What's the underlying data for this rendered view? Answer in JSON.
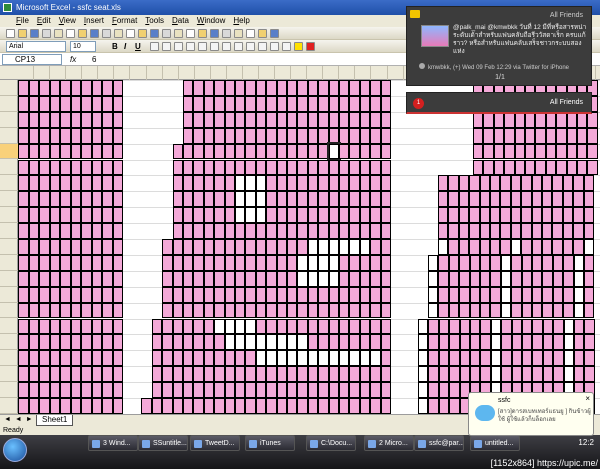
{
  "window": {
    "title": "Microsoft Excel - ssfc seat.xls"
  },
  "menu": [
    "File",
    "Edit",
    "View",
    "Insert",
    "Format",
    "Tools",
    "Data",
    "Window",
    "Help"
  ],
  "toolbar": {
    "font": "Arial",
    "size": "10",
    "bold": "B",
    "italic": "I",
    "underline": "U"
  },
  "formula": {
    "cell": "CP13",
    "fx": "fx",
    "value": "6"
  },
  "columns": [
    "BM",
    "BN",
    "BO",
    "BP",
    "BQ",
    "BR",
    "BS",
    "BT",
    "BU",
    "BV",
    "BW",
    "BX",
    "BY",
    "BZ",
    "CA",
    "CB",
    "CC",
    "CD",
    "CE",
    "CF",
    "CG",
    "CH",
    "CI",
    "CJ",
    "CK",
    "CL",
    "CM",
    "CN",
    "CO",
    "CP",
    "CQ",
    "CR",
    "CS",
    "CT",
    "CU",
    "CV"
  ],
  "selected_column": "CP",
  "rows": [
    9,
    10,
    11,
    12,
    13,
    14,
    15,
    16,
    17,
    18,
    19,
    20,
    21,
    22,
    23,
    24,
    25,
    26,
    27,
    28,
    29
  ],
  "selected_row": 13,
  "pink": "#f4a9d8",
  "grid_rows": [
    {
      "left": [
        "10",
        "9",
        "8",
        "7",
        "6",
        "5",
        "4",
        "3",
        "2",
        "1"
      ],
      "right": [
        "20",
        "19",
        "18",
        "17",
        "16",
        "15",
        "14",
        "13",
        "12",
        "11",
        "10",
        "9",
        "8",
        "7",
        "6",
        "5",
        "4",
        "3",
        "2",
        "1"
      ],
      "white": []
    },
    {
      "left": [
        "10",
        "9",
        "8",
        "7",
        "6",
        "5",
        "4",
        "3",
        "2",
        "1"
      ],
      "right": [
        "20",
        "19",
        "18",
        "17",
        "16",
        "15",
        "14",
        "13",
        "12",
        "11",
        "10",
        "9",
        "8",
        "7",
        "6",
        "5",
        "4",
        "3",
        "2",
        "1"
      ],
      "white": []
    },
    {
      "left": [
        "10",
        "9",
        "8",
        "7",
        "6",
        "5",
        "4",
        "3",
        "2",
        "1"
      ],
      "right": [
        "20",
        "19",
        "18",
        "17",
        "16",
        "15",
        "14",
        "13",
        "12",
        "11",
        "10",
        "9",
        "8",
        "7",
        "6",
        "5",
        "4",
        "3",
        "2",
        "1"
      ],
      "white": []
    },
    {
      "left": [
        "10",
        "9",
        "8",
        "7",
        "6",
        "5",
        "4",
        "3",
        "2",
        "1"
      ],
      "right": [
        "20",
        "19",
        "18",
        "17",
        "16",
        "15",
        "14",
        "13",
        "12",
        "11",
        "10",
        "9",
        "8",
        "7",
        "6",
        "5",
        "4",
        "3",
        "2",
        "1"
      ],
      "white": []
    },
    {
      "left": [
        "10",
        "9",
        "8",
        "7",
        "6",
        "5",
        "4",
        "3",
        "2",
        "1"
      ],
      "right": [
        "21",
        "20",
        "19",
        "18",
        "17",
        "16",
        "15",
        "14",
        "13",
        "12",
        "11",
        "10",
        "9",
        "8",
        "7",
        "6",
        "5",
        "4",
        "3",
        "2",
        "1"
      ],
      "white": [
        15
      ]
    },
    {
      "left": [
        "10",
        "9",
        "8",
        "7",
        "6",
        "5",
        "4",
        "3",
        "2",
        "1"
      ],
      "right": [
        "21",
        "20",
        "19",
        "18",
        "17",
        "16",
        "15",
        "14",
        "13",
        "12",
        "11",
        "10",
        "9",
        "8",
        "7",
        "6",
        "5",
        "4",
        "3",
        "2",
        "1"
      ],
      "white": []
    },
    {
      "left": [
        "10",
        "9",
        "8",
        "7",
        "6",
        "5",
        "4",
        "3",
        "2",
        "1"
      ],
      "right": [
        "21",
        "20",
        "19",
        "18",
        "17",
        "16",
        "15",
        "14",
        "13",
        "12",
        "11",
        "10",
        "9",
        "8",
        "7",
        "6",
        "5",
        "4",
        "3",
        "2",
        "1"
      ],
      "white": [
        6,
        7,
        8
      ]
    },
    {
      "left": [
        "10",
        "9",
        "8",
        "7",
        "6",
        "5",
        "4",
        "3",
        "2",
        "1"
      ],
      "right": [
        "21",
        "20",
        "19",
        "18",
        "17",
        "16",
        "15",
        "14",
        "13",
        "12",
        "11",
        "10",
        "9",
        "8",
        "7",
        "6",
        "5",
        "4",
        "3",
        "2",
        "1"
      ],
      "white": [
        6,
        7,
        8
      ]
    },
    {
      "left": [
        "10",
        "9",
        "8",
        "7",
        "6",
        "5",
        "4",
        "3",
        "2",
        "1"
      ],
      "right": [
        "21",
        "20",
        "19",
        "18",
        "17",
        "16",
        "15",
        "14",
        "13",
        "12",
        "11",
        "10",
        "9",
        "8",
        "7",
        "6",
        "5",
        "4",
        "3",
        "2",
        "1"
      ],
      "white": [
        6,
        7,
        8
      ]
    },
    {
      "left": [
        "10",
        "9",
        "8",
        "7",
        "6",
        "5",
        "4",
        "3",
        "2",
        "1"
      ],
      "right": [
        "21",
        "20",
        "19",
        "18",
        "17",
        "16",
        "15",
        "14",
        "13",
        "12",
        "11",
        "10",
        "9",
        "8",
        "7",
        "6",
        "5",
        "4",
        "3",
        "2",
        "1"
      ],
      "white": []
    },
    {
      "left": [
        "10",
        "9",
        "8",
        "7",
        "6",
        "5",
        "4",
        "3",
        "2",
        "1"
      ],
      "right": [
        "22",
        "21",
        "20",
        "19",
        "18",
        "17",
        "16",
        "15",
        "14",
        "13",
        "12",
        "11",
        "10",
        "9",
        "8",
        "7",
        "6",
        "5",
        "4",
        "3",
        "2",
        "1"
      ],
      "white": [
        14,
        15,
        16,
        17,
        18,
        19
      ]
    },
    {
      "left": [
        "10",
        "9",
        "8",
        "7",
        "6",
        "5",
        "4",
        "3",
        "2",
        "1"
      ],
      "right": [
        "22",
        "21",
        "20",
        "19",
        "18",
        "17",
        "16",
        "15",
        "14",
        "13",
        "12",
        "11",
        "10",
        "9",
        "8",
        "7",
        "6",
        "5",
        "4",
        "3",
        "2",
        "1"
      ],
      "white": [
        13,
        14,
        15,
        16
      ]
    },
    {
      "left": [
        "10",
        "9",
        "8",
        "7",
        "6",
        "5",
        "4",
        "3",
        "2",
        "1"
      ],
      "right": [
        "22",
        "21",
        "20",
        "19",
        "18",
        "17",
        "16",
        "15",
        "14",
        "13",
        "12",
        "11",
        "10",
        "9",
        "8",
        "7",
        "6",
        "5",
        "4",
        "3",
        "2",
        "1"
      ],
      "white": [
        13,
        14,
        15,
        16
      ]
    },
    {
      "left": [
        "10",
        "9",
        "8",
        "7",
        "6",
        "5",
        "4",
        "3",
        "2",
        "1"
      ],
      "right": [
        "22",
        "21",
        "20",
        "19",
        "18",
        "17",
        "16",
        "15",
        "14",
        "13",
        "12",
        "11",
        "10",
        "9",
        "8",
        "7",
        "6",
        "5",
        "4",
        "3",
        "2",
        "1"
      ],
      "white": []
    },
    {
      "left": [
        "10",
        "9",
        "8",
        "7",
        "6",
        "5",
        "4",
        "3",
        "2",
        "1"
      ],
      "right": [
        "22",
        "21",
        "20",
        "19",
        "18",
        "17",
        "16",
        "15",
        "14",
        "13",
        "12",
        "11",
        "10",
        "9",
        "8",
        "7",
        "6",
        "5",
        "4",
        "3",
        "2",
        "1"
      ],
      "white": []
    },
    {
      "left": [
        "10",
        "9",
        "8",
        "7",
        "6",
        "5",
        "4",
        "3",
        "2",
        "1"
      ],
      "right": [
        "23",
        "22",
        "21",
        "20",
        "19",
        "18",
        "17",
        "16",
        "15",
        "14",
        "13",
        "12",
        "11",
        "10",
        "9",
        "8",
        "7",
        "6",
        "5",
        "4",
        "3",
        "2",
        "1"
      ],
      "white": [
        6,
        7,
        8,
        9
      ]
    },
    {
      "left": [
        "10",
        "9",
        "8",
        "7",
        "6",
        "5",
        "4",
        "3",
        "2",
        "1"
      ],
      "right": [
        "23",
        "22",
        "21",
        "20",
        "19",
        "18",
        "17",
        "16",
        "15",
        "14",
        "13",
        "12",
        "11",
        "10",
        "9",
        "8",
        "7",
        "6",
        "5",
        "4",
        "3",
        "2",
        "1"
      ],
      "white": [
        7,
        8,
        9,
        10,
        11,
        12,
        13,
        14
      ]
    },
    {
      "left": [
        "10",
        "9",
        "8",
        "7",
        "6",
        "5",
        "4",
        "3",
        "2",
        "1"
      ],
      "right": [
        "23",
        "22",
        "21",
        "20",
        "19",
        "18",
        "17",
        "16",
        "15",
        "14",
        "13",
        "12",
        "11",
        "10",
        "9",
        "8",
        "7",
        "6",
        "5",
        "4",
        "3",
        "2",
        "1"
      ],
      "white": [
        10,
        11,
        12,
        13,
        14,
        15,
        16,
        17,
        18,
        19,
        20,
        21
      ]
    },
    {
      "left": [
        "10",
        "9",
        "8",
        "7",
        "6",
        "5",
        "4",
        "3",
        "2",
        "1"
      ],
      "right": [
        "23",
        "22",
        "21",
        "20",
        "19",
        "18",
        "17",
        "16",
        "15",
        "14",
        "13",
        "12",
        "11",
        "10",
        "9",
        "8",
        "7",
        "6",
        "5",
        "4",
        "3",
        "2",
        "1"
      ],
      "white": []
    },
    {
      "left": [
        "10",
        "9",
        "8",
        "7",
        "6",
        "5",
        "4",
        "3",
        "2",
        "1"
      ],
      "right": [
        "23",
        "22",
        "21",
        "20",
        "19",
        "18",
        "17",
        "16",
        "15",
        "14",
        "13",
        "12",
        "11",
        "10",
        "9",
        "8",
        "7",
        "6",
        "5",
        "4",
        "3",
        "2",
        "1"
      ],
      "white": []
    },
    {
      "left": [
        "10",
        "9",
        "8",
        "7",
        "6",
        "5",
        "4",
        "3",
        "2",
        "1"
      ],
      "right": [
        "24",
        "23",
        "22",
        "21",
        "20",
        "19",
        "18",
        "17",
        "16",
        "15",
        "14",
        "13",
        "12",
        "11",
        "10",
        "9",
        "8",
        "7",
        "6",
        "5",
        "4",
        "3",
        "2",
        "1"
      ],
      "white": []
    }
  ],
  "sheets": {
    "nav": "◄ ◄ ► ►",
    "active": "Sheet1"
  },
  "status": {
    "text": "Ready"
  },
  "taskbar": {
    "buttons": [
      "3 Wind...",
      "SSuntitle...",
      "TweetD...",
      "iTunes",
      "C:\\Docu...",
      "2 Micro...",
      "ssfc@par...",
      "untitled..."
    ],
    "clock": "12:2"
  },
  "tweet": {
    "header": "All Friends",
    "text": "@palk_mai @kmwbkk วันที่ 12 มีที่หรือสารหน่า ระดับเด้าสำหรับแฟนคลับถือรีววัสดาเร็ก ครบแก้ ราว? หรือสำหรับแฟนคลับเสร็จชาวกระบบสองแห่ง",
    "meta": "kmwbkk, (+) Wed 09 Feb 12:29 via Twitter for iPhone",
    "page": "1/1"
  },
  "friends": {
    "count": "1",
    "label": "All Friends"
  },
  "notification": {
    "title": "ssfc",
    "body": "[สาว]ดารสเบทเทอร์แธนยู ] กินข้าวผู้ใช้ ผู้ใช้แล้วก็บล็อกเลย",
    "close": "×"
  },
  "watermark": "[1152x864] https://upic.me/"
}
